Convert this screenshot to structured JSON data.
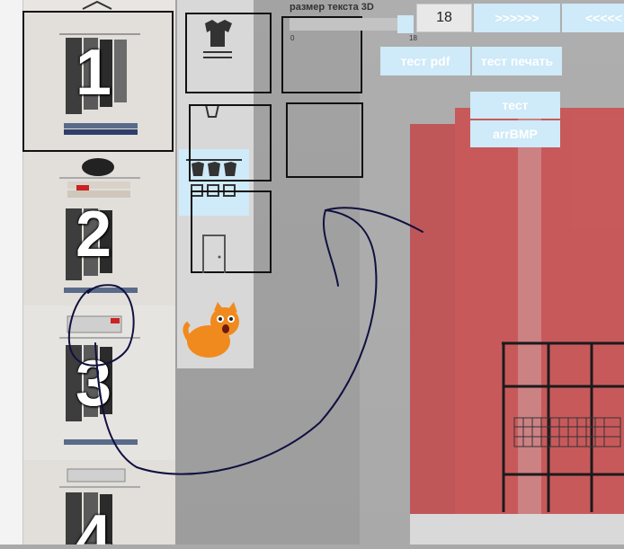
{
  "thumbnails": [
    {
      "number": "1"
    },
    {
      "number": "2"
    },
    {
      "number": "3"
    },
    {
      "number": "4"
    }
  ],
  "scale_3d": {
    "label": "размер текста 3D",
    "min_label": "0",
    "max_label": "18",
    "value": "18",
    "fraction": 1.0
  },
  "nav": {
    "forward_label": ">>>>>>",
    "back_label": "<<<<<"
  },
  "buttons": {
    "test_pdf": "тест pdf",
    "test_print": "тест печать",
    "test": "тест",
    "arr_bmp": "arrBMP"
  },
  "colors": {
    "button_bg": "#cfeaf8",
    "accent_wall": "#c23b3e",
    "annotation": "#101040"
  },
  "icons": [
    "tshirt-shelf-icon",
    "basket-icon",
    "hanger-rack-icon",
    "door-icon",
    "cat-sticker-icon"
  ]
}
